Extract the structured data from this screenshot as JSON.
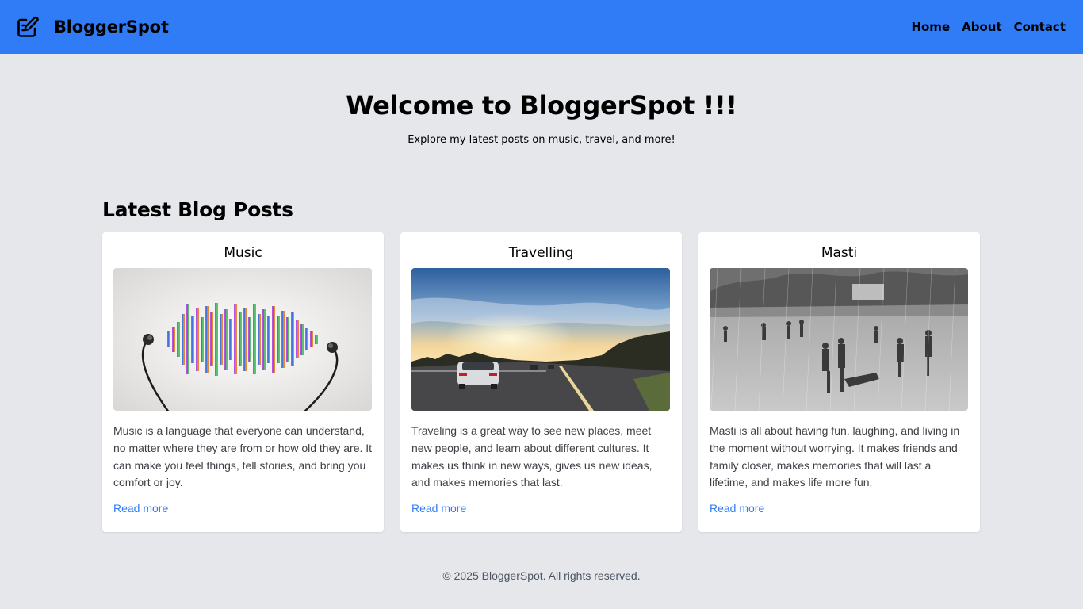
{
  "header": {
    "brand_icon": "edit-icon",
    "brand_name": "BloggerSpot",
    "nav": [
      {
        "label": "Home"
      },
      {
        "label": "About"
      },
      {
        "label": "Contact"
      }
    ],
    "accent_color": "#2f7cf6"
  },
  "hero": {
    "title": "Welcome to BloggerSpot !!!",
    "subtitle": "Explore my latest posts on music, travel, and more!"
  },
  "posts": {
    "heading": "Latest Blog Posts",
    "items": [
      {
        "title": "Music",
        "image": "music-equalizer-earphones-image",
        "excerpt": "Music is a language that everyone can understand, no matter where they are from or how old they are. It can make you feel things, tell stories, and bring you comfort or joy.",
        "link": "Read more"
      },
      {
        "title": "Travelling",
        "image": "car-on-highway-sunset-image",
        "excerpt": "Traveling is a great way to see new places, meet new people, and learn about different cultures. It makes us think in new ways, gives us new ideas, and makes memories that last.",
        "link": "Read more"
      },
      {
        "title": "Masti",
        "image": "kids-playing-in-rain-image",
        "excerpt": "Masti is all about having fun, laughing, and living in the moment without worrying. It makes friends and family closer, makes memories that will last a lifetime, and makes life more fun.",
        "link": "Read more"
      }
    ]
  },
  "footer": {
    "text": "© 2025 BloggerSpot. All rights reserved."
  }
}
